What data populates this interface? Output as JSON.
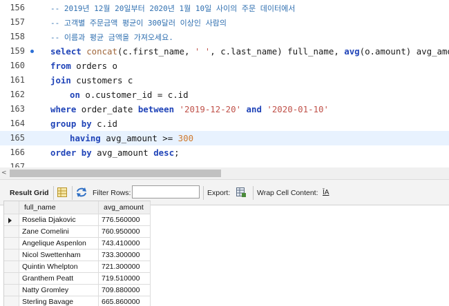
{
  "editor": {
    "lines": [
      {
        "num": "156",
        "parts": [
          {
            "t": "-- 2019년 12월 20일부터 2020년 1월 10일 사이의 주문 데이터에서",
            "c": "cm"
          }
        ]
      },
      {
        "num": "157",
        "parts": [
          {
            "t": "-- 고객별 주문금액 평균이 300달러 이상인 사람의",
            "c": "cm"
          }
        ]
      },
      {
        "num": "158",
        "parts": [
          {
            "t": "-- 이름과 평균 금액을 가져오세요.",
            "c": "cm"
          }
        ]
      },
      {
        "num": "159",
        "bp": true,
        "parts": [
          {
            "t": "select ",
            "c": "kw"
          },
          {
            "t": "concat",
            "c": "fn"
          },
          {
            "t": "(c.first_name, ",
            "c": ""
          },
          {
            "t": "' '",
            "c": "str"
          },
          {
            "t": ", c.last_name) full_name, ",
            "c": ""
          },
          {
            "t": "avg",
            "c": "kw"
          },
          {
            "t": "(o.amount) avg_amount",
            "c": ""
          }
        ]
      },
      {
        "num": "160",
        "parts": [
          {
            "t": "from",
            "c": "kw"
          },
          {
            "t": " orders o",
            "c": ""
          }
        ]
      },
      {
        "num": "161",
        "parts": [
          {
            "t": "join",
            "c": "kw"
          },
          {
            "t": " customers c",
            "c": ""
          }
        ]
      },
      {
        "num": "162",
        "indent": true,
        "parts": [
          {
            "t": "on",
            "c": "kw"
          },
          {
            "t": " o.customer_id = c.id",
            "c": ""
          }
        ]
      },
      {
        "num": "163",
        "parts": [
          {
            "t": "where",
            "c": "kw"
          },
          {
            "t": " order_date ",
            "c": ""
          },
          {
            "t": "between",
            "c": "kw"
          },
          {
            "t": " ",
            "c": ""
          },
          {
            "t": "'2019-12-20'",
            "c": "str"
          },
          {
            "t": " ",
            "c": ""
          },
          {
            "t": "and",
            "c": "kw"
          },
          {
            "t": " ",
            "c": ""
          },
          {
            "t": "'2020-01-10'",
            "c": "str"
          }
        ]
      },
      {
        "num": "164",
        "parts": [
          {
            "t": "group by",
            "c": "kw"
          },
          {
            "t": " c.id",
            "c": ""
          }
        ]
      },
      {
        "num": "165",
        "indent": true,
        "highlight": true,
        "parts": [
          {
            "t": "having",
            "c": "kw"
          },
          {
            "t": " avg_amount >= ",
            "c": ""
          },
          {
            "t": "300",
            "c": "num"
          }
        ]
      },
      {
        "num": "166",
        "parts": [
          {
            "t": "order by",
            "c": "kw"
          },
          {
            "t": " avg_amount ",
            "c": ""
          },
          {
            "t": "desc",
            "c": "kw"
          },
          {
            "t": ";",
            "c": ""
          }
        ]
      },
      {
        "num": "167",
        "parts": []
      }
    ]
  },
  "toolbar": {
    "result_grid_label": "Result Grid",
    "filter_rows_label": "Filter Rows:",
    "filter_value": "",
    "export_label": "Export:",
    "wrap_label": "Wrap Cell Content:",
    "wrap_icon_glyph": "ĪA",
    "hscroll_arrow": "<"
  },
  "grid": {
    "columns": [
      "full_name",
      "avg_amount"
    ],
    "rows": [
      [
        "Roselia Djakovic",
        "776.560000"
      ],
      [
        "Zane Comelini",
        "760.950000"
      ],
      [
        "Angelique Aspenlon",
        "743.410000"
      ],
      [
        "Nicol Swettenham",
        "733.300000"
      ],
      [
        "Quintin Whelpton",
        "721.300000"
      ],
      [
        "Granthem Peatt",
        "719.510000"
      ],
      [
        "Natty Gromley",
        "709.880000"
      ],
      [
        "Sterling Bavage",
        "665.860000"
      ]
    ]
  }
}
